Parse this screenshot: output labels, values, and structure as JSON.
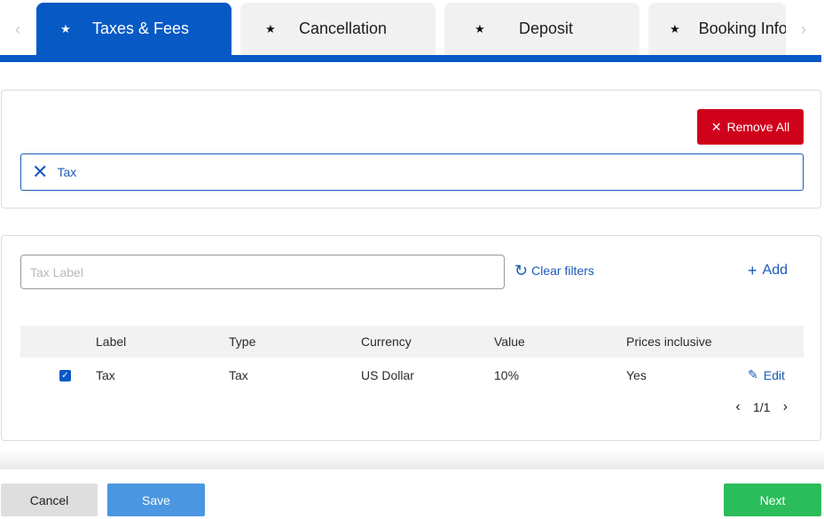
{
  "tabs": [
    {
      "label": "Taxes & Fees",
      "icon": "star-icon",
      "active": true
    },
    {
      "label": "Cancellation",
      "icon": "star-icon",
      "active": false
    },
    {
      "label": "Deposit",
      "icon": "star-icon",
      "active": false
    },
    {
      "label": "Booking Info",
      "icon": "star-icon",
      "active": false
    }
  ],
  "filters": {
    "remove_all_label": "Remove All",
    "chips": [
      {
        "label": "Tax"
      }
    ]
  },
  "search": {
    "placeholder": "Tax Label",
    "value": ""
  },
  "actions": {
    "clear_filters_label": "Clear filters",
    "add_label": "Add"
  },
  "table": {
    "columns": [
      "Label",
      "Type",
      "Currency",
      "Value",
      "Prices inclusive"
    ],
    "rows": [
      {
        "checked": true,
        "label": "Tax",
        "type": "Tax",
        "currency": "US Dollar",
        "value": "10%",
        "prices_inclusive": "Yes",
        "edit_label": "Edit"
      }
    ]
  },
  "pagination": {
    "text": "1/1"
  },
  "footer": {
    "cancel_label": "Cancel",
    "save_label": "Save",
    "next_label": "Next"
  },
  "colors": {
    "primary": "#0759c4",
    "danger": "#d0021b",
    "success": "#2bbd5b",
    "save": "#4a96e0"
  }
}
